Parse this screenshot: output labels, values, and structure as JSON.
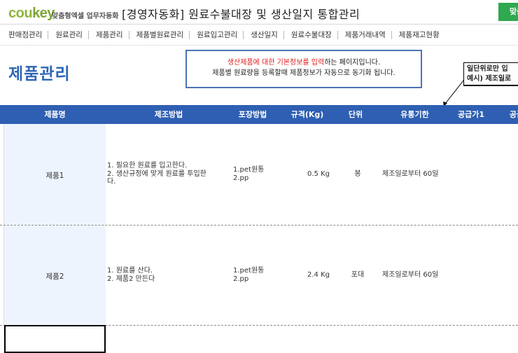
{
  "header": {
    "brand_a": "cou",
    "brand_b": "key",
    "brand_sub": "맞춤형엑셀 업무자동화",
    "app_title": "[경영자동화] 원료수불대장 및 생산일지 통합관리",
    "green_button": "맞춤"
  },
  "nav": [
    "판매점관리",
    "원료관리",
    "제품관리",
    "제품별원료관리",
    "원료입고관리",
    "생산일지",
    "원료수불대장",
    "제품거래내역",
    "제품재고현황"
  ],
  "page_title": "제품관리",
  "notice": {
    "line1_red": "생산제품에 대한 기본정보를 입력",
    "line1_rest": "하는 페이지입니다.",
    "line2": "제품별 원료량을 등록할때 제품정보가 자동으로 동기화 됩니다."
  },
  "note": {
    "line1": "일단위로만 입",
    "line2": "예시) 제조일로"
  },
  "columns": [
    "제품명",
    "제조방법",
    "포장방법",
    "규격(Kg)",
    "단위",
    "유통기한",
    "공급가1",
    "공급"
  ],
  "rows": [
    {
      "name": "제품1",
      "method": [
        "1. 필요한 원료를 입고한다.",
        "2. 생산규정에 맞게 원료를 투입한",
        "다."
      ],
      "packaging": [
        "1.pet원통",
        "2.pp"
      ],
      "spec": "0.5 Kg",
      "unit": "봉",
      "shelf_life": "제조일로부터 60일"
    },
    {
      "name": "제품2",
      "method": [
        "1. 원료를 산다.",
        "2. 제품2 만든다"
      ],
      "packaging": [
        "1.pet원통",
        "2.pp"
      ],
      "spec": "2.4 Kg",
      "unit": "포대",
      "shelf_life": "제조일로부터 60일"
    }
  ],
  "colors": {
    "accent": "#2e5fb2",
    "title": "#2e66b5",
    "brand": "#8fb53c",
    "green": "#2fa84f",
    "red": "#e21b1b"
  }
}
